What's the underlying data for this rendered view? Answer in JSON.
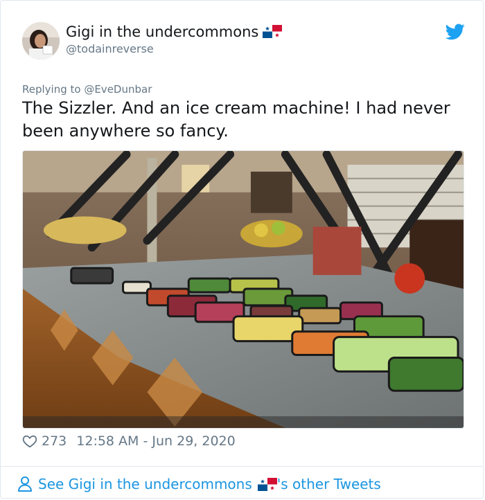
{
  "author": {
    "display_name": "Gigi in the undercommons",
    "flag_icon": "panama-flag-icon",
    "handle": "@todainreverse"
  },
  "reply": {
    "label": "Replying to @EveDunbar"
  },
  "tweet": {
    "text": "The Sizzler. And an ice cream machine! I had never been anywhere so fancy."
  },
  "meta": {
    "likes": "273",
    "timestamp": "12:58 AM - Jun 29, 2020"
  },
  "footer": {
    "prefix": "See Gigi in the undercommons",
    "suffix": "'s other Tweets"
  },
  "colors": {
    "link": "#1b95e0",
    "secondary_text": "#657786",
    "twitter_blue": "#1da1f2"
  }
}
